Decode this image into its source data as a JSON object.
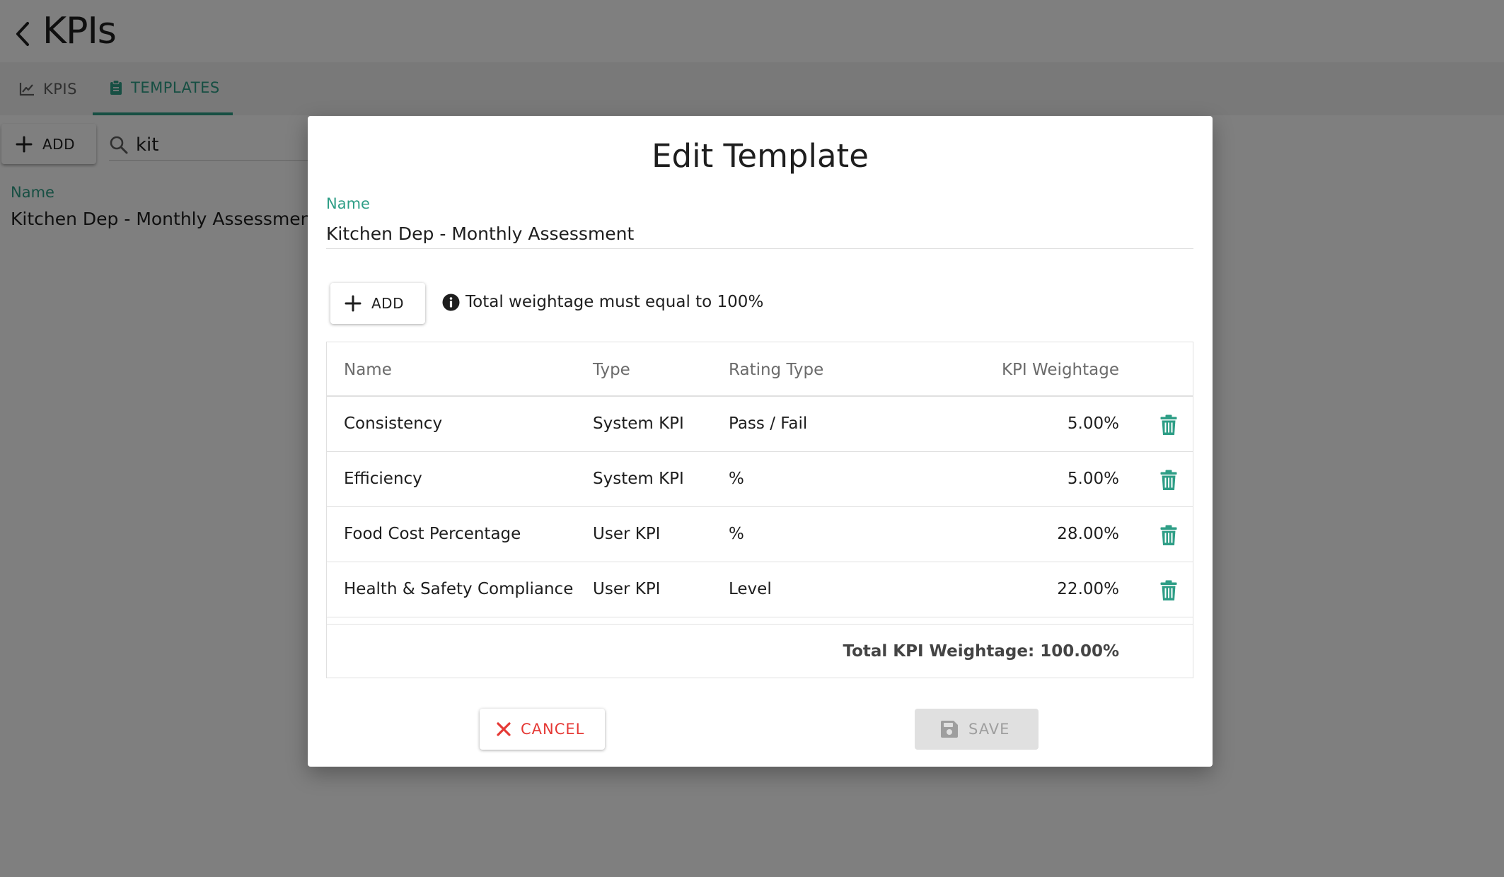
{
  "header": {
    "title": "KPIs"
  },
  "tabs": [
    {
      "label": "KPIS",
      "icon": "line-chart-icon",
      "active": false
    },
    {
      "label": "TEMPLATES",
      "icon": "clipboard-icon",
      "active": true
    }
  ],
  "toolbar": {
    "add_label": "ADD",
    "search_value": "kit"
  },
  "list": {
    "column_label": "Name",
    "rows": [
      "Kitchen Dep - Monthly Assessment"
    ]
  },
  "dialog": {
    "title": "Edit Template",
    "name_label": "Name",
    "name_value": "Kitchen Dep - Monthly Assessment",
    "add_label": "ADD",
    "hint": "Total weightage must equal to 100%",
    "columns": {
      "name": "Name",
      "type": "Type",
      "rating_type": "Rating Type",
      "weightage": "KPI Weightage"
    },
    "rows": [
      {
        "name": "Consistency",
        "type": "System KPI",
        "rating_type": "Pass / Fail",
        "weightage": "5.00%"
      },
      {
        "name": "Efficiency",
        "type": "System KPI",
        "rating_type": "%",
        "weightage": "5.00%"
      },
      {
        "name": "Food Cost Percentage",
        "type": "User KPI",
        "rating_type": "%",
        "weightage": "28.00%"
      },
      {
        "name": "Health & Safety Compliance",
        "type": "User KPI",
        "rating_type": "Level",
        "weightage": "22.00%"
      }
    ],
    "total": "Total KPI Weightage: 100.00%",
    "cancel_label": "CANCEL",
    "save_label": "SAVE"
  },
  "colors": {
    "accent": "#2e9e86",
    "danger": "#e53935",
    "disabled_bg": "#e0e0e0",
    "disabled_text": "#9e9e9e",
    "overlay": "rgba(0,0,0,0.5)"
  }
}
